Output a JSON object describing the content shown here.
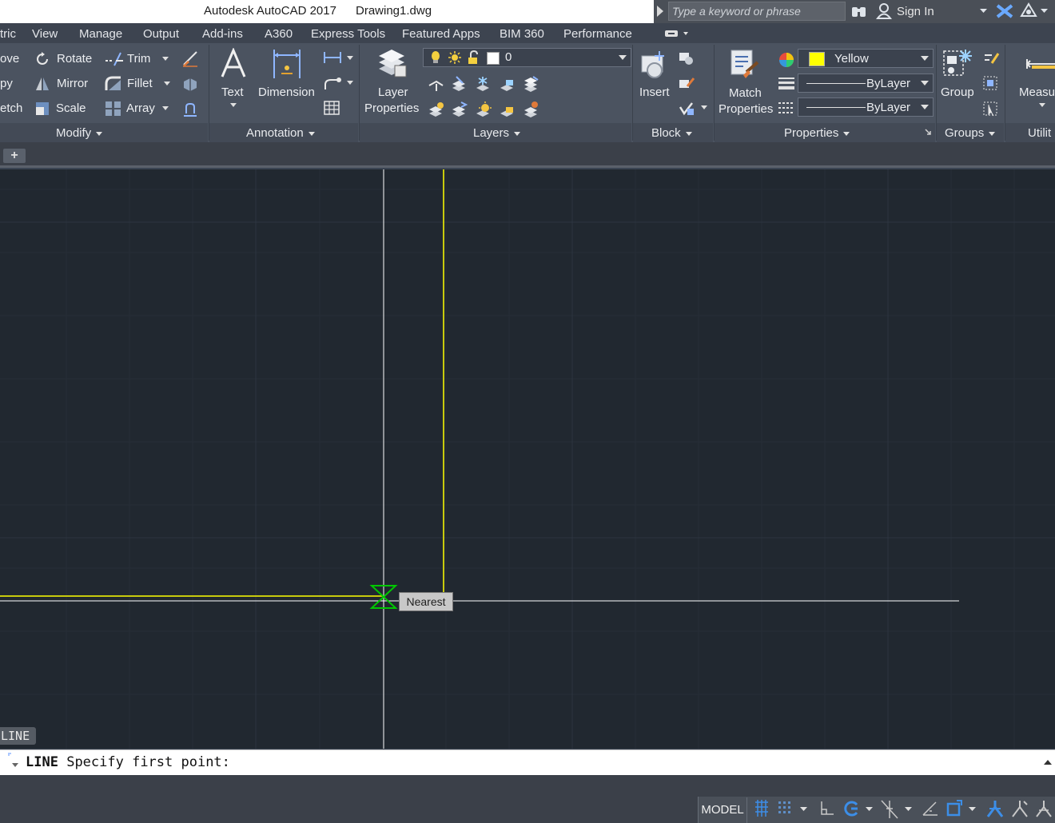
{
  "window": {
    "app_title": "Autodesk AutoCAD 2017",
    "document_title": "Drawing1.dwg"
  },
  "search": {
    "placeholder": "Type a keyword or phrase"
  },
  "account": {
    "sign_in_label": "Sign In"
  },
  "ribbon_tabs": [
    "tric",
    "View",
    "Manage",
    "Output",
    "Add-ins",
    "A360",
    "Express Tools",
    "Featured Apps",
    "BIM 360",
    "Performance"
  ],
  "modify_panel": {
    "title": "Modify",
    "left_cut": [
      "ove",
      "py",
      "etch"
    ],
    "tools": {
      "rotate": "Rotate",
      "mirror": "Mirror",
      "scale": "Scale",
      "trim": "Trim",
      "fillet": "Fillet",
      "array": "Array"
    }
  },
  "annotation_panel": {
    "title": "Annotation",
    "text": "Text",
    "dimension": "Dimension"
  },
  "layers_panel": {
    "title": "Layers",
    "layer_properties_line1": "Layer",
    "layer_properties_line2": "Properties",
    "current_layer": "0"
  },
  "block_panel": {
    "title": "Block",
    "insert": "Insert"
  },
  "properties_panel": {
    "title": "Properties",
    "match_line1": "Match",
    "match_line2": "Properties",
    "color_value": "Yellow",
    "color_swatch": "#ffff00",
    "linetype_value": "ByLayer",
    "lineweight_value": "ByLayer"
  },
  "groups_panel": {
    "title": "Groups",
    "group": "Group"
  },
  "utilities_panel": {
    "title": "Utilit",
    "measure": "Measu"
  },
  "drawing": {
    "snap_tooltip": "Nearest",
    "active_command_tag": "LINE",
    "line_color": "#ffff00",
    "crosshair_color": "#ffffff",
    "snap_marker_color": "#00c800"
  },
  "command_line": {
    "command": "LINE",
    "prompt": "Specify first point:"
  },
  "status_bar": {
    "model_label": "MODEL"
  }
}
